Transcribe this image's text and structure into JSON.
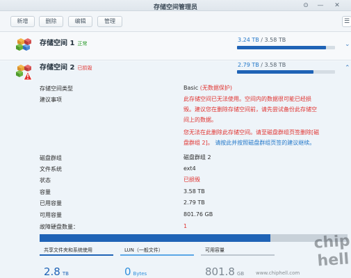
{
  "window": {
    "title": "存储空间管理员"
  },
  "toolbar": {
    "create": "新增",
    "delete": "删除",
    "edit": "编辑",
    "manage": "管理"
  },
  "colors": {
    "accent": "#1f63b6",
    "link": "#2277c9",
    "ok": "#2a9a2a",
    "error": "#e0322f"
  },
  "volumes": [
    {
      "name": "存储空间 1",
      "status": "正常",
      "used": "3.24 TB",
      "sep": " / ",
      "total": "3.58 TB",
      "used_fraction": 0.905,
      "icon": "volume-cube-icon"
    },
    {
      "name": "存储空间 2",
      "status": "已损毁",
      "used": "2.79 TB",
      "sep": " / ",
      "total": "3.58 TB",
      "used_fraction": 0.779,
      "icon": "volume-cube-warning-icon"
    }
  ],
  "details": {
    "type_label": "存储空间类型",
    "type_value": "Basic",
    "type_note": "(无数据保护)",
    "advice_label": "建议事项",
    "advice_lines": [
      "此存储空间已无法使用。空间内的数据很可能已经损",
      "毁。建议您在删除存储空间前，请先尝试备份此存储空",
      "间上的数据。",
      "您无法在此删除此存储空间。请至磁盘群组页签删除[磁",
      "盘群组 2]。"
    ],
    "advice_link": "请按此并按照磁盘群组页签的建议继续。",
    "rows": [
      {
        "label": "磁盘群组",
        "value": "磁盘群组 2"
      },
      {
        "label": "文件系统",
        "value": "ext4"
      },
      {
        "label": "状态",
        "value": "已损毁"
      },
      {
        "label": "容量",
        "value": "3.58 TB"
      },
      {
        "label": "已用容量",
        "value": "2.79 TB"
      },
      {
        "label": "可用容量",
        "value": "801.76 GB"
      },
      {
        "label": "故障硬盘数量：",
        "value": "1"
      }
    ],
    "used_fraction": 0.75
  },
  "cards": [
    {
      "title": "共享文件夹和系统使用",
      "value": "2.8",
      "unit": "TB"
    },
    {
      "title": "LUN（一般文件）",
      "value": "0",
      "unit": "Bytes"
    },
    {
      "title": "可用容量",
      "value": "801.8",
      "unit": "GB"
    }
  ],
  "watermark": {
    "logo": "chip hell",
    "url": "www.chiphell.com"
  }
}
